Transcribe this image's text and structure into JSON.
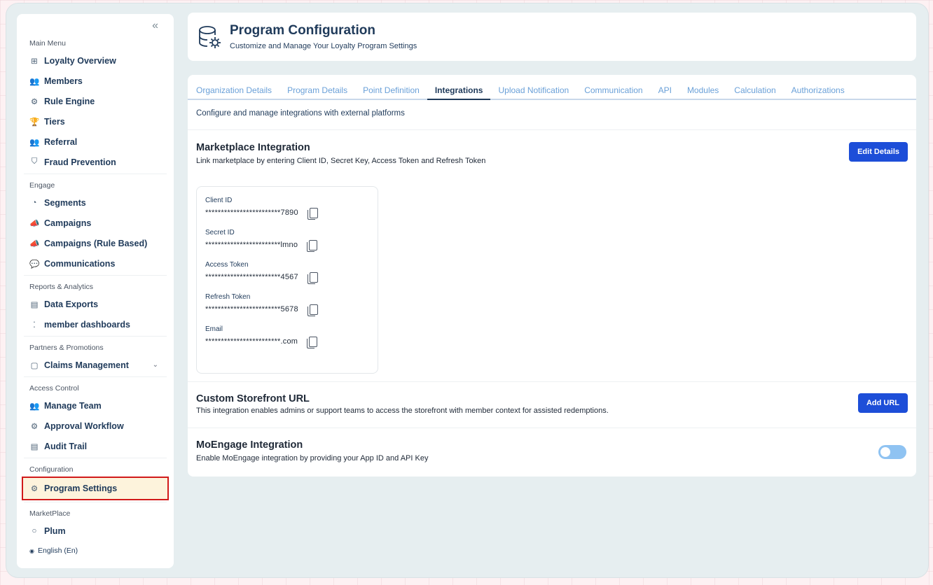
{
  "sidebar": {
    "collapse_glyph": "«",
    "sections": [
      {
        "label": "Main Menu",
        "items": [
          {
            "label": "Loyalty Overview",
            "icon": "dashboard-icon",
            "glyph": "⊞"
          },
          {
            "label": "Members",
            "icon": "members-icon",
            "glyph": "👥"
          },
          {
            "label": "Rule Engine",
            "icon": "rule-engine-icon",
            "glyph": "⚙"
          },
          {
            "label": "Tiers",
            "icon": "trophy-icon",
            "glyph": "🏆"
          },
          {
            "label": "Referral",
            "icon": "referral-icon",
            "glyph": "👥"
          },
          {
            "label": "Fraud Prevention",
            "icon": "shield-icon",
            "glyph": "⛉"
          }
        ]
      },
      {
        "label": "Engage",
        "items": [
          {
            "label": "Segments",
            "icon": "pie-chart-icon",
            "glyph": "◔"
          },
          {
            "label": "Campaigns",
            "icon": "megaphone-icon",
            "glyph": "📣"
          },
          {
            "label": "Campaigns (Rule Based)",
            "icon": "megaphone-icon",
            "glyph": "📣"
          },
          {
            "label": "Communications",
            "icon": "chat-icon",
            "glyph": "💬"
          }
        ]
      },
      {
        "label": "Reports & Analytics",
        "items": [
          {
            "label": "Data Exports",
            "icon": "file-export-icon",
            "glyph": "▤"
          },
          {
            "label": "member dashboards",
            "icon": "dots-icon",
            "glyph": "⁚"
          }
        ]
      },
      {
        "label": "Partners & Promotions",
        "items": [
          {
            "label": "Claims Management",
            "icon": "claims-icon",
            "glyph": "▢",
            "chevron": "⌄"
          }
        ]
      },
      {
        "label": "Access Control",
        "items": [
          {
            "label": "Manage Team",
            "icon": "team-icon",
            "glyph": "👥"
          },
          {
            "label": "Approval Workflow",
            "icon": "workflow-icon",
            "glyph": "⚙"
          },
          {
            "label": "Audit Trail",
            "icon": "audit-icon",
            "glyph": "▤"
          }
        ]
      },
      {
        "label": "Configuration",
        "items": [
          {
            "label": "Program Settings",
            "icon": "settings-icon",
            "glyph": "⚙",
            "active": true
          }
        ]
      },
      {
        "label": "MarketPlace",
        "items": [
          {
            "label": "Plum",
            "icon": "plum-icon",
            "glyph": "○"
          }
        ]
      }
    ],
    "language": "English (En)",
    "language_glyph": "◉"
  },
  "header": {
    "title": "Program Configuration",
    "subtitle": "Customize and Manage Your Loyalty Program Settings"
  },
  "tabs": [
    {
      "label": "Organization Details"
    },
    {
      "label": "Program Details"
    },
    {
      "label": "Point Definition"
    },
    {
      "label": "Integrations",
      "active": true
    },
    {
      "label": "Upload Notification"
    },
    {
      "label": "Communication"
    },
    {
      "label": "API"
    },
    {
      "label": "Modules"
    },
    {
      "label": "Calculation"
    },
    {
      "label": "Authorizations"
    }
  ],
  "description": "Configure and manage integrations with external platforms",
  "marketplace": {
    "title": "Marketplace Integration",
    "description": "Link marketplace by entering Client ID, Secret Key, Access Token and Refresh Token",
    "button": "Edit Details",
    "credentials": [
      {
        "label": "Client ID",
        "value": "************************7890"
      },
      {
        "label": "Secret ID",
        "value": "************************lmno"
      },
      {
        "label": "Access Token",
        "value": "************************4567"
      },
      {
        "label": "Refresh Token",
        "value": "************************5678"
      },
      {
        "label": "Email",
        "value": "************************.com"
      }
    ]
  },
  "storefront": {
    "title": "Custom Storefront URL",
    "description": "This integration enables admins or support teams to access the storefront with member context for assisted redemptions.",
    "button": "Add URL"
  },
  "moengage": {
    "title": "MoEngage Integration",
    "description": "Enable MoEngage integration by providing your App ID and API Key",
    "enabled": false
  },
  "colors": {
    "primary": "#1d4ed8",
    "navy": "#1f3a5a",
    "tab_inactive": "#6aa0d8",
    "highlight_border": "#d11a1a",
    "highlight_bg": "#fdf3dc"
  }
}
